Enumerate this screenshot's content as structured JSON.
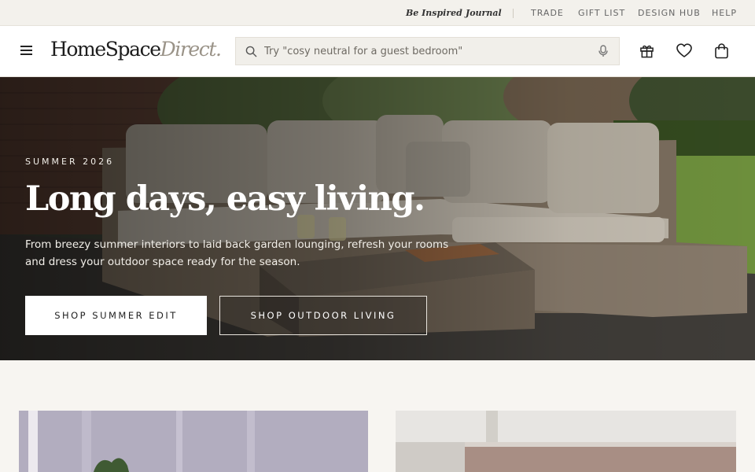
{
  "utility_bar": {
    "editorial_links": [
      "Be Inspired",
      "Journal"
    ],
    "links": [
      "TRADE",
      "GIFT LIST",
      "DESIGN HUB",
      "HELP"
    ]
  },
  "header": {
    "logo_main": "HomeSpace",
    "logo_accent": "Direct.",
    "search": {
      "placeholder": "Try \"cosy neutral for a guest bedroom\"",
      "value": ""
    },
    "icons": [
      "menu-icon",
      "search-icon",
      "microphone-icon",
      "gift-icon",
      "heart-icon",
      "shopping-bag-icon"
    ]
  },
  "hero": {
    "eyebrow": "SUMMER 2026",
    "headline": "Long days, easy living.",
    "subcopy": "From breezy summer interiors to laid back garden lounging, refresh your rooms and dress your outdoor space ready for the season.",
    "primary_cta": "SHOP SUMMER EDIT",
    "secondary_cta": "SHOP OUTDOOR LIVING"
  },
  "colors": {
    "page_bg": "#f7f5f1",
    "utility_bg": "#f3f1ec",
    "logo_accent": "#9a9388",
    "search_bg": "#f1efea"
  }
}
